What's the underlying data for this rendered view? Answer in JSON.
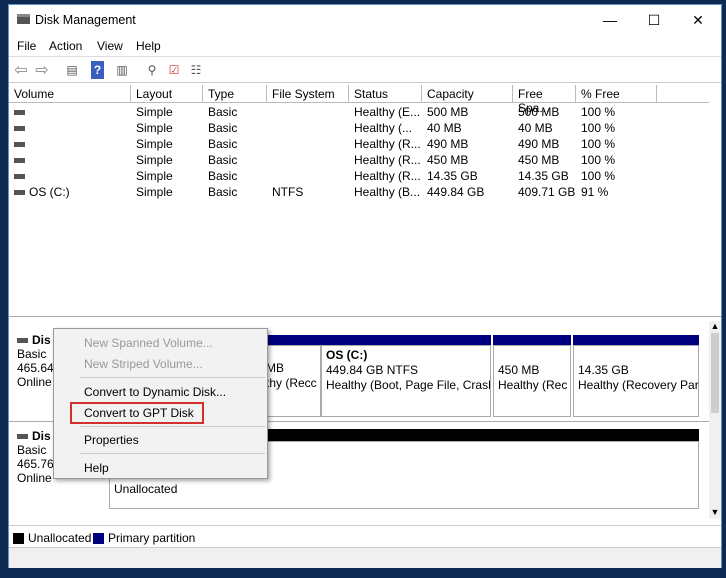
{
  "window": {
    "title": "Disk Management",
    "minimize": "—",
    "maximize": "☐",
    "close": "✕"
  },
  "menu": [
    "File",
    "Action",
    "View",
    "Help"
  ],
  "toolbar_icons": [
    "back-icon",
    "forward-icon",
    "console-tree-icon",
    "help-icon",
    "action-pane-icon",
    "connect-icon",
    "check-icon",
    "properties-icon"
  ],
  "columns": [
    "Volume",
    "Layout",
    "Type",
    "File System",
    "Status",
    "Capacity",
    "Free Spa...",
    "% Free"
  ],
  "rows": [
    {
      "volume": "",
      "layout": "Simple",
      "type": "Basic",
      "fs": "",
      "status": "Healthy (E...",
      "capacity": "500 MB",
      "free": "500 MB",
      "pct": "100 %"
    },
    {
      "volume": "",
      "layout": "Simple",
      "type": "Basic",
      "fs": "",
      "status": "Healthy (...",
      "capacity": "40 MB",
      "free": "40 MB",
      "pct": "100 %"
    },
    {
      "volume": "",
      "layout": "Simple",
      "type": "Basic",
      "fs": "",
      "status": "Healthy (R...",
      "capacity": "490 MB",
      "free": "490 MB",
      "pct": "100 %"
    },
    {
      "volume": "",
      "layout": "Simple",
      "type": "Basic",
      "fs": "",
      "status": "Healthy (R...",
      "capacity": "450 MB",
      "free": "450 MB",
      "pct": "100 %"
    },
    {
      "volume": "",
      "layout": "Simple",
      "type": "Basic",
      "fs": "",
      "status": "Healthy (R...",
      "capacity": "14.35 GB",
      "free": "14.35 GB",
      "pct": "100 %"
    },
    {
      "volume": "OS (C:)",
      "layout": "Simple",
      "type": "Basic",
      "fs": "NTFS",
      "status": "Healthy (B...",
      "capacity": "449.84 GB",
      "free": "409.71 GB",
      "pct": "91 %"
    }
  ],
  "disks": [
    {
      "name": "Dis",
      "type": "Basic",
      "size": "465.64",
      "state": "Online",
      "partitions": [
        {
          "line1": "",
          "line2": "MB",
          "line3": "thy (Recc"
        },
        {
          "line1": "OS  (C:)",
          "line2": "449.84 GB NTFS",
          "line3": "Healthy (Boot, Page File, Crash"
        },
        {
          "line1": "",
          "line2": "450 MB",
          "line3": "Healthy (Rec"
        },
        {
          "line1": "",
          "line2": "14.35 GB",
          "line3": "Healthy (Recovery Part"
        }
      ]
    },
    {
      "name": "Dis",
      "type": "Basic",
      "size": "465.76",
      "state": "Online",
      "partitions": [
        {
          "line1": "Unallocated"
        }
      ]
    }
  ],
  "legend": [
    {
      "label": "Unallocated",
      "color": "#000000"
    },
    {
      "label": "Primary partition",
      "color": "#00007f"
    }
  ],
  "context_menu": {
    "items": [
      {
        "label": "New Spanned Volume...",
        "enabled": false
      },
      {
        "label": "New Striped Volume...",
        "enabled": false
      },
      {
        "label": "Convert to Dynamic Disk...",
        "enabled": true
      },
      {
        "label": "Convert to GPT Disk",
        "enabled": true,
        "highlighted": true
      },
      {
        "label": "Properties",
        "enabled": true
      },
      {
        "label": "Help",
        "enabled": true
      }
    ]
  },
  "colors": {
    "highlight_box": "#d32f2f",
    "primary_partition": "#00007f",
    "unallocated": "#000000"
  }
}
